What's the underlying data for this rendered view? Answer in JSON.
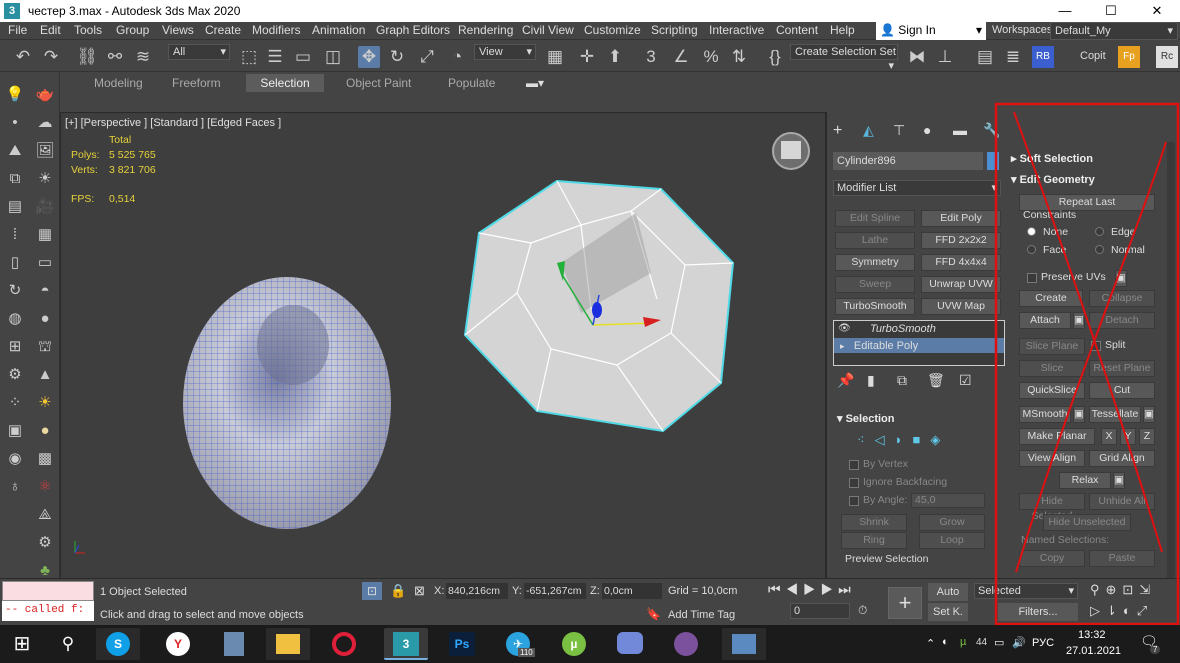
{
  "titlebar": {
    "app_icon": "3",
    "title": "честер 3.max - Autodesk 3ds Max 2020",
    "minimize": "—",
    "maximize": "☐",
    "close": "✕"
  },
  "menubar": {
    "items": [
      "File",
      "Edit",
      "Tools",
      "Group",
      "Views",
      "Create",
      "Modifiers",
      "Animation",
      "Graph Editors",
      "Rendering",
      "Civil View",
      "Customize",
      "Scripting",
      "Interactive",
      "Content",
      "Help"
    ],
    "sign_in": "Sign In",
    "workspaces_label": "Workspaces:",
    "workspace": "Default_My"
  },
  "toolbar": {
    "selection_filter": "All",
    "ref_coord": "View",
    "named_selection": "Create Selection Set",
    "copit": "Copit"
  },
  "ribbon": {
    "tabs": [
      "Modeling",
      "Freeform",
      "Selection",
      "Object Paint",
      "Populate"
    ],
    "active": "Selection"
  },
  "viewport": {
    "label": "[+] [Perspective ] [Standard ] [Edged Faces ]",
    "stats": {
      "total_label": "Total",
      "polys_label": "Polys:",
      "polys": "5 525 765",
      "verts_label": "Verts:",
      "verts": "3 821 706",
      "fps_label": "FPS:",
      "fps": "0,514"
    }
  },
  "command_panel": {
    "object_name": "Cylinder896",
    "modifier_list": "Modifier List",
    "modifier_buttons": [
      [
        "Edit Spline",
        "Edit Poly"
      ],
      [
        "Lathe",
        "FFD 2x2x2"
      ],
      [
        "Symmetry",
        "FFD 4x4x4"
      ],
      [
        "Sweep",
        "Unwrap UVW"
      ],
      [
        "TurboSmooth",
        "UVW Map"
      ]
    ],
    "stack": [
      "TurboSmooth",
      "Editable Poly"
    ],
    "selection": {
      "title": "Selection",
      "by_vertex": "By Vertex",
      "ignore_backfacing": "Ignore Backfacing",
      "by_angle": "By Angle:",
      "angle_value": "45,0",
      "shrink": "Shrink",
      "grow": "Grow",
      "ring": "Ring",
      "loop": "Loop",
      "preview": "Preview Selection"
    }
  },
  "edit_geometry": {
    "soft_selection": "Soft Selection",
    "title": "Edit Geometry",
    "repeat_last": "Repeat Last",
    "constraints": "Constraints",
    "none": "None",
    "edge": "Edge",
    "face": "Face",
    "normal": "Normal",
    "preserve_uvs": "Preserve UVs",
    "create": "Create",
    "collapse": "Collapse",
    "attach": "Attach",
    "detach": "Detach",
    "slice_plane": "Slice Plane",
    "split": "Split",
    "slice": "Slice",
    "reset_plane": "Reset Plane",
    "quickslice": "QuickSlice",
    "cut": "Cut",
    "msmooth": "MSmooth",
    "tessellate": "Tessellate",
    "make_planar": "Make Planar",
    "x": "X",
    "y": "Y",
    "z": "Z",
    "view_align": "View Align",
    "grid_align": "Grid Align",
    "relax": "Relax",
    "hide_selected": "Hide Selected",
    "unhide_all": "Unhide All",
    "hide_unselected": "Hide Unselected",
    "named_selections": "Named Selections:",
    "copy": "Copy",
    "paste": "Paste"
  },
  "status": {
    "script_line": "-- called f:",
    "objects_selected": "1 Object Selected",
    "prompt": "Click and drag to select and move objects",
    "x_label": "X:",
    "x": "840,216cm",
    "y_label": "Y:",
    "y": "-651,267cm",
    "z_label": "Z:",
    "z": "0,0cm",
    "grid": "Grid = 10,0cm",
    "add_time_tag": "Add Time Tag",
    "auto": "Auto",
    "setk": "Set K.",
    "selected": "Selected",
    "filters": "Filters...",
    "frame": "0"
  },
  "taskbar": {
    "time": "13:32",
    "date": "27.01.2021",
    "lang": "РУС",
    "notif": "7",
    "telegram_badge": "110",
    "vol": "44",
    "apps": [
      "start-icon",
      "search-icon",
      "skype-icon",
      "yandex-icon",
      "calculator-icon",
      "explorer-icon",
      "opera-icon",
      "3dsmax-icon",
      "photoshop-icon",
      "telegram-icon",
      "utorrent-icon",
      "discord-icon",
      "viber-icon",
      "photos-icon"
    ]
  },
  "colors": {
    "accent": "#5a7ca6",
    "stats": "#e7d23a",
    "annotation": "#e01010",
    "selection": "#4fd9e6",
    "wire": "#2e4bd6"
  }
}
